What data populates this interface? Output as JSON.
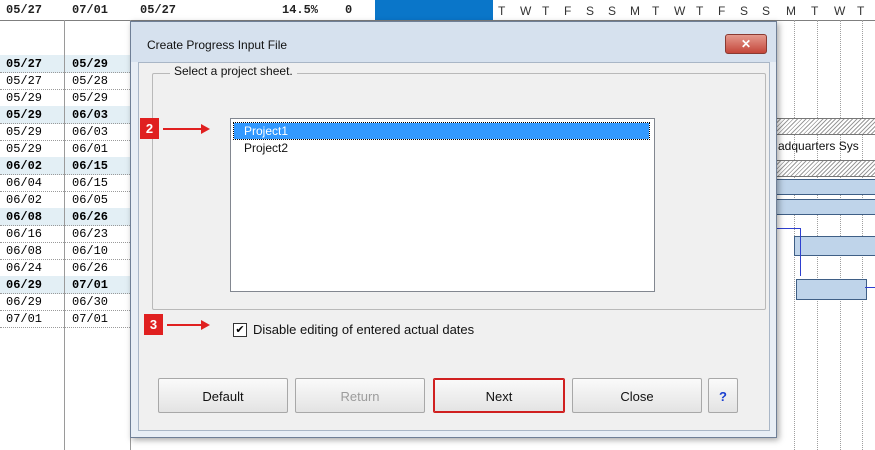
{
  "spreadsheet": {
    "top_row": [
      "05/27",
      "07/01",
      "05/27",
      "14.5%",
      "0"
    ],
    "rows": [
      {
        "start": "05/27",
        "end": "05/29",
        "bold": true
      },
      {
        "start": "05/27",
        "end": "05/28",
        "bold": false
      },
      {
        "start": "05/29",
        "end": "05/29",
        "bold": false
      },
      {
        "start": "05/29",
        "end": "06/03",
        "bold": true
      },
      {
        "start": "05/29",
        "end": "06/03",
        "bold": false
      },
      {
        "start": "05/29",
        "end": "06/01",
        "bold": false
      },
      {
        "start": "06/02",
        "end": "06/15",
        "bold": true
      },
      {
        "start": "06/04",
        "end": "06/15",
        "bold": false
      },
      {
        "start": "06/02",
        "end": "06/05",
        "bold": false
      },
      {
        "start": "06/08",
        "end": "06/26",
        "bold": true
      },
      {
        "start": "06/16",
        "end": "06/23",
        "bold": false
      },
      {
        "start": "06/08",
        "end": "06/10",
        "bold": false
      },
      {
        "start": "06/24",
        "end": "06/26",
        "bold": false
      },
      {
        "start": "06/29",
        "end": "07/01",
        "bold": true
      },
      {
        "start": "06/29",
        "end": "06/30",
        "bold": false
      },
      {
        "start": "07/01",
        "end": "07/01",
        "bold": false
      }
    ],
    "gantt_days": [
      "T",
      "W",
      "T",
      "F",
      "S",
      "S",
      "M",
      "T",
      "W",
      "T",
      "F",
      "S",
      "S",
      "M",
      "T",
      "W",
      "T"
    ],
    "gantt_side_text": "adquarters Sys"
  },
  "dialog": {
    "title": "Create Progress Input File",
    "close_glyph": "✕",
    "group_label": "Select a project sheet.",
    "projects": [
      {
        "name": "Project1",
        "selected": true
      },
      {
        "name": "Project2",
        "selected": false
      }
    ],
    "checkbox": {
      "label": "Disable editing of entered actual dates",
      "checked": true,
      "glyph": "✔"
    },
    "buttons": {
      "default": "Default",
      "return": "Return",
      "next": "Next",
      "close": "Close",
      "help": "?"
    }
  },
  "annotations": {
    "marker_2": "2",
    "marker_3": "3",
    "color": "#e02020"
  },
  "colors": {
    "selection": "#3399ff",
    "title_bar": "#d6e1ee",
    "header_block": "#0a76c9"
  }
}
